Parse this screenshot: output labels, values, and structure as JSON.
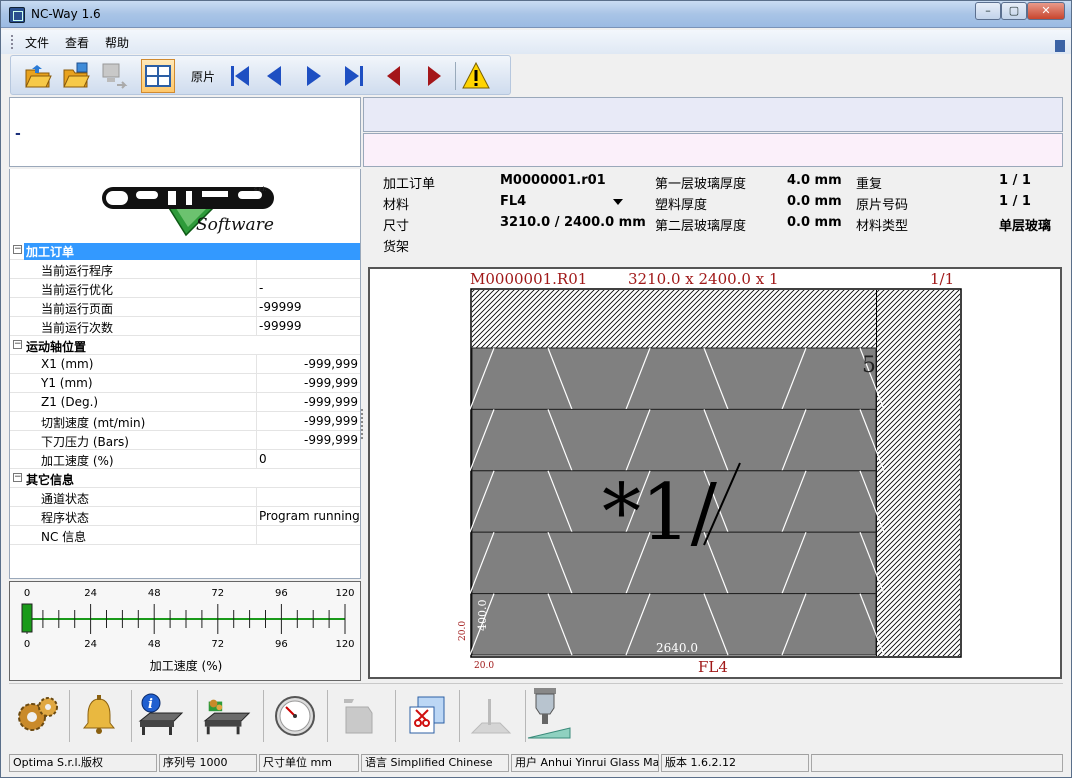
{
  "window": {
    "title": "NC-Way 1.6"
  },
  "menu": {
    "items": [
      "文件",
      "查看",
      "帮助"
    ]
  },
  "toolbar": {
    "label": "原片",
    "buttons": [
      "open-folder-icon",
      "open-program-icon",
      "send-icon",
      "layout-grid-icon",
      "first-icon",
      "previous-icon",
      "next-icon",
      "last-icon",
      "previous-red-icon",
      "next-red-icon",
      "warning-icon"
    ]
  },
  "message": {
    "left_text": "-"
  },
  "tree": {
    "groups": [
      {
        "label": "加工订单",
        "rows": [
          {
            "key": "当前运行程序",
            "value": ""
          },
          {
            "key": "当前运行优化",
            "value": "-"
          },
          {
            "key": "当前运行页面",
            "value": "-99999"
          },
          {
            "key": "当前运行次数",
            "value": "-99999"
          }
        ]
      },
      {
        "label": "运动轴位置",
        "rows": [
          {
            "key": "X1 (mm)",
            "value": "-999,999"
          },
          {
            "key": "Y1 (mm)",
            "value": "-999,999"
          },
          {
            "key": "Z1 (Deg.)",
            "value": "-999,999"
          },
          {
            "key": "切割速度 (mt/min)",
            "value": "-999,999"
          },
          {
            "key": "下刀压力 (Bars)",
            "value": "-999,999"
          },
          {
            "key": "加工速度 (%)",
            "value": "0"
          }
        ]
      },
      {
        "label": "其它信息",
        "rows": [
          {
            "key": "通道状态",
            "value": ""
          },
          {
            "key": "程序状态",
            "value": "Program running"
          },
          {
            "key": "NC 信息",
            "value": ""
          }
        ]
      }
    ]
  },
  "gauge": {
    "ticks": [
      "0",
      "24",
      "48",
      "72",
      "96",
      "120"
    ],
    "label": "加工速度 (%)",
    "value": 0
  },
  "info": {
    "order_label": "加工订单",
    "order_value": "M0000001.r01",
    "material_label": "材料",
    "material_value": "FL4",
    "size_label": "尺寸",
    "size_value": "3210.0 / 2400.0 mm",
    "rack_label": "货架",
    "layer1_label": "第一层玻璃厚度",
    "layer1_value": "4.0 mm",
    "plastic_label": "塑料厚度",
    "plastic_value": "0.0 mm",
    "layer2_label": "第二层玻璃厚度",
    "layer2_value": "0.0 mm",
    "repeat_label": "重复",
    "repeat_value": "1 / 1",
    "sheetno_label": "原片号码",
    "sheetno_value": "1 / 1",
    "mattype_label": "材料类型",
    "mattype_value": "单层玻璃"
  },
  "drawing": {
    "header_left": "M0000001.R01",
    "header_mid": "3210.0  x  2400.0  x 1",
    "header_right": "1/1",
    "piece_count": "5",
    "center_label": "*1/",
    "bottom_dim": "2640.0",
    "side_dim": "400.0",
    "corner_left": "20.0",
    "corner_bottom": "20.0",
    "material": "FL4"
  },
  "bottom_tools": [
    "gears-icon",
    "bell-icon",
    "info-table-icon",
    "cutting-table-icon",
    "pressure-gauge-icon",
    "disabled-tool-icon",
    "cut-layout-icon",
    "blade-disabled-icon",
    "cutting-head-icon"
  ],
  "status": {
    "company": "Optima S.r.l.版权",
    "serial": "序列号 1000",
    "unit": "尺寸单位 mm",
    "language": "语言 Simplified Chinese",
    "user": "用户 Anhui Yinrui Glass Mac",
    "version": "版本 1.6.2.12"
  },
  "colors": {
    "accent": "#3399ff",
    "plate": "#808080",
    "drawing_red": "#a01818"
  }
}
